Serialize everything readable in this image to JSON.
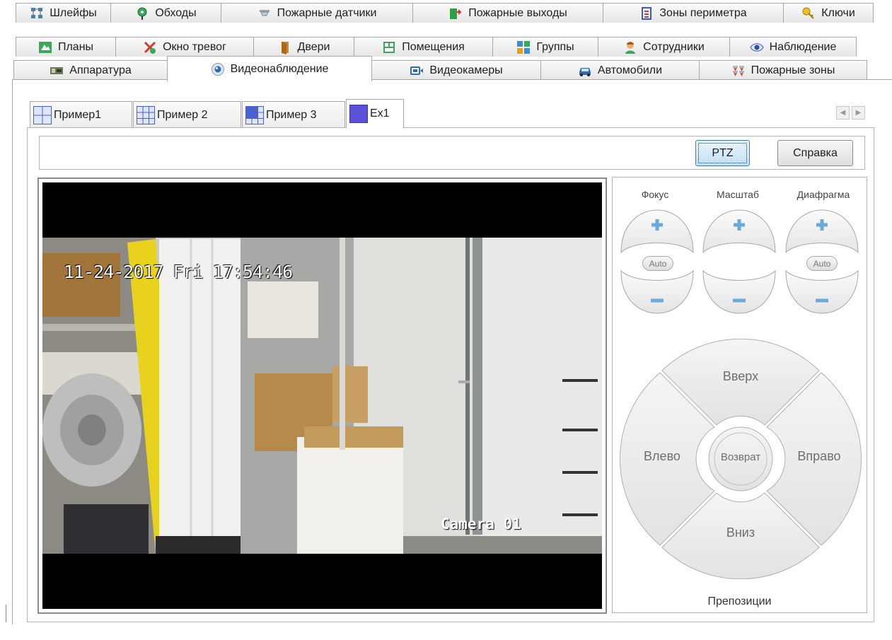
{
  "main_tabs": {
    "row1": [
      {
        "label": "Шлейфы",
        "icon": "loops-icon"
      },
      {
        "label": "Обходы",
        "icon": "patrol-icon"
      },
      {
        "label": "Пожарные датчики",
        "icon": "fire-sensor-icon"
      },
      {
        "label": "Пожарные выходы",
        "icon": "fire-exit-icon"
      },
      {
        "label": "Зоны периметра",
        "icon": "perimeter-icon"
      },
      {
        "label": "Ключи",
        "icon": "key-icon"
      }
    ],
    "row2": [
      {
        "label": "Планы",
        "icon": "plans-icon"
      },
      {
        "label": "Окно тревог",
        "icon": "alarm-icon"
      },
      {
        "label": "Двери",
        "icon": "door-icon"
      },
      {
        "label": "Помещения",
        "icon": "rooms-icon"
      },
      {
        "label": "Группы",
        "icon": "groups-icon"
      },
      {
        "label": "Сотрудники",
        "icon": "employee-icon"
      },
      {
        "label": "Наблюдение",
        "icon": "eye-icon"
      }
    ],
    "row3": [
      {
        "label": "Аппаратура",
        "icon": "hardware-icon"
      },
      {
        "label": "Видеонаблюдение",
        "icon": "video-surveillance-icon",
        "active": true
      },
      {
        "label": "Видеокамеры",
        "icon": "camera-icon"
      },
      {
        "label": "Автомобили",
        "icon": "car-icon"
      },
      {
        "label": "Пожарные зоны",
        "icon": "fire-zone-icon"
      }
    ]
  },
  "view_tabs": [
    {
      "label": "Пример1",
      "layout": "2x2"
    },
    {
      "label": "Пример 2",
      "layout": "3x3"
    },
    {
      "label": "Пример 3",
      "layout": "1+5"
    },
    {
      "label": "Ex1",
      "layout": "1x1",
      "active": true
    }
  ],
  "toolbar": {
    "ptz_label": "PTZ",
    "help_label": "Справка"
  },
  "video": {
    "timestamp": "11-24-2017 Fri 17:54:46",
    "camera_name": "Camera 01"
  },
  "ptz": {
    "focus_label": "Фокус",
    "zoom_label": "Масштаб",
    "iris_label": "Диафрагма",
    "auto_label": "Auto",
    "up_label": "Вверх",
    "down_label": "Вниз",
    "left_label": "Влево",
    "right_label": "Вправо",
    "home_label": "Возврат",
    "presets_label": "Препозиции"
  },
  "colors": {
    "accent": "#3c7fb1",
    "plus_minus": "#6aa9d8",
    "tab_border": "#a8a8a8"
  }
}
